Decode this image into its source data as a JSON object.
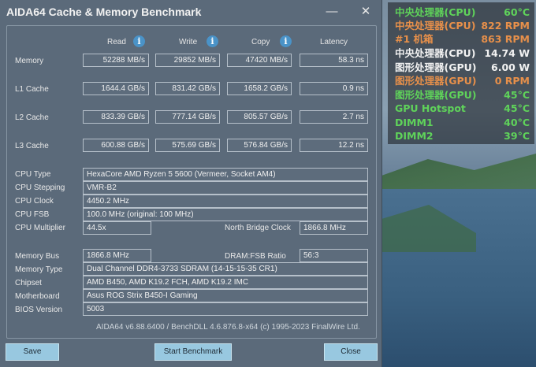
{
  "window": {
    "title": "AIDA64 Cache & Memory Benchmark",
    "minimize_glyph": "—",
    "close_glyph": "✕"
  },
  "columns": {
    "read": "Read",
    "write": "Write",
    "copy": "Copy",
    "latency": "Latency"
  },
  "rows": [
    {
      "label": "Memory",
      "read": "52288 MB/s",
      "write": "29852 MB/s",
      "copy": "47420 MB/s",
      "latency": "58.3 ns"
    },
    {
      "label": "L1 Cache",
      "read": "1644.4 GB/s",
      "write": "831.42 GB/s",
      "copy": "1658.2 GB/s",
      "latency": "0.9 ns"
    },
    {
      "label": "L2 Cache",
      "read": "833.39 GB/s",
      "write": "777.14 GB/s",
      "copy": "805.57 GB/s",
      "latency": "2.7 ns"
    },
    {
      "label": "L3 Cache",
      "read": "600.88 GB/s",
      "write": "575.69 GB/s",
      "copy": "576.84 GB/s",
      "latency": "12.2 ns"
    }
  ],
  "cpu": {
    "type_label": "CPU Type",
    "type": "HexaCore AMD Ryzen 5 5600  (Vermeer, Socket AM4)",
    "stepping_label": "CPU Stepping",
    "stepping": "VMR-B2",
    "clock_label": "CPU Clock",
    "clock": "4450.2 MHz",
    "fsb_label": "CPU FSB",
    "fsb": "100.0 MHz  (original: 100 MHz)",
    "multiplier_label": "CPU Multiplier",
    "multiplier": "44.5x",
    "nb_clock_label": "North Bridge Clock",
    "nb_clock": "1866.8 MHz"
  },
  "memory": {
    "bus_label": "Memory Bus",
    "bus": "1866.8 MHz",
    "ratio_label": "DRAM:FSB Ratio",
    "ratio": "56:3",
    "type_label": "Memory Type",
    "type": "Dual Channel DDR4-3733 SDRAM  (14-15-15-35 CR1)",
    "chipset_label": "Chipset",
    "chipset": "AMD B450, AMD K19.2 FCH, AMD K19.2 IMC",
    "motherboard_label": "Motherboard",
    "motherboard": "Asus ROG Strix B450-I Gaming",
    "bios_label": "BIOS Version",
    "bios": "5003"
  },
  "footer": "AIDA64 v6.88.6400 / BenchDLL 4.6.876.8-x64  (c) 1995-2023 FinalWire Ltd.",
  "buttons": {
    "save": "Save",
    "start": "Start Benchmark",
    "close": "Close"
  },
  "info_glyph": "i",
  "osd": [
    {
      "label": "中央处理器(CPU)",
      "value": "60°C",
      "color": "#5fd35a"
    },
    {
      "label": "中央处理器(CPU)",
      "value": "822 RPM",
      "color": "#e8904a"
    },
    {
      "label": "#1 机箱",
      "value": "863 RPM",
      "color": "#e8904a"
    },
    {
      "label": "中央处理器(CPU)",
      "value": "14.74 W",
      "color": "#f2f2f2"
    },
    {
      "label": "图形处理器(GPU)",
      "value": "6.00 W",
      "color": "#f2f2f2"
    },
    {
      "label": "图形处理器(GPU)",
      "value": "0 RPM",
      "color": "#e8904a"
    },
    {
      "label": "图形处理器(GPU)",
      "value": "45°C",
      "color": "#5fd35a"
    },
    {
      "label": "GPU Hotspot",
      "value": "45°C",
      "color": "#5fd35a"
    },
    {
      "label": "DIMM1",
      "value": "40°C",
      "color": "#5fd35a"
    },
    {
      "label": "DIMM2",
      "value": "39°C",
      "color": "#5fd35a"
    }
  ]
}
